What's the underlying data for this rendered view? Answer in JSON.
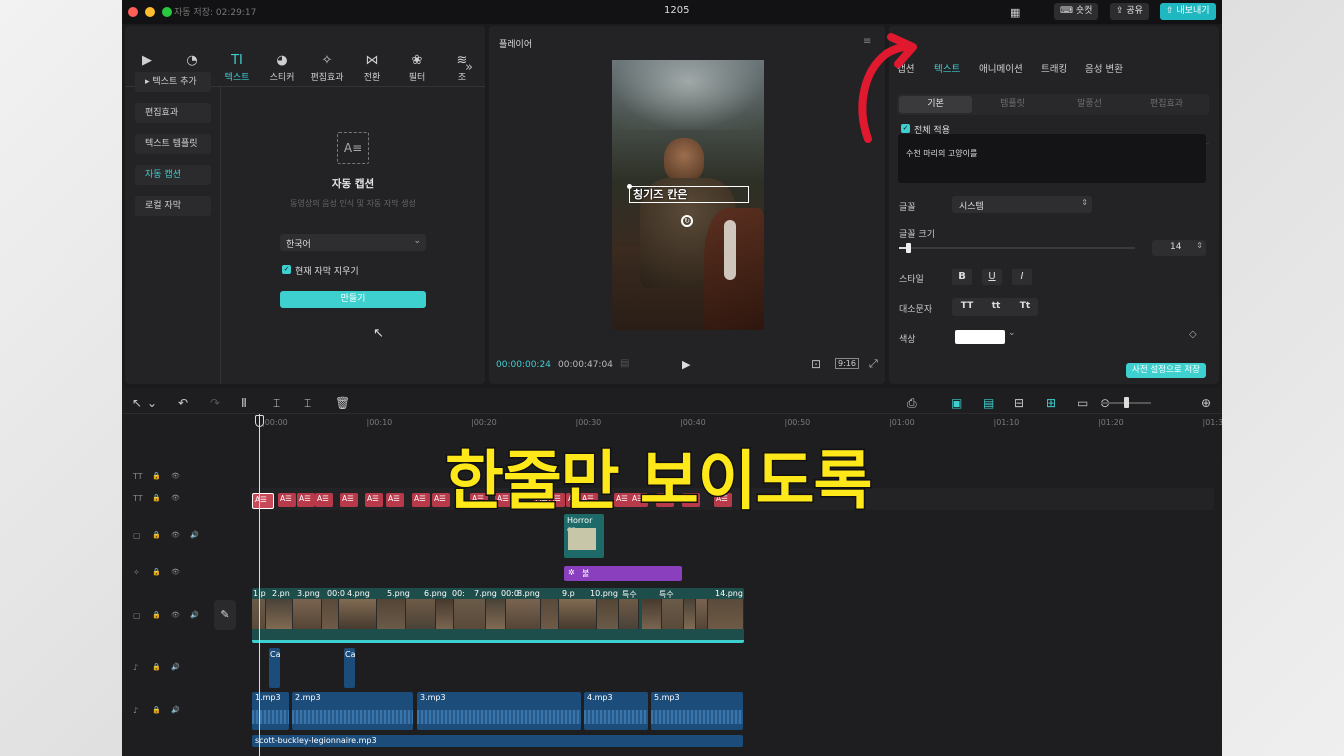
{
  "titlebar": {
    "autosave": "자동 저장: 02:29:17",
    "project_name": "1205",
    "shortcut_label": "숏컷",
    "share_label": "공유",
    "export_label": "내보내기"
  },
  "toolbar": {
    "items": [
      {
        "label": "미디어",
        "icon": "media-icon"
      },
      {
        "label": "오디오",
        "icon": "audio-icon"
      },
      {
        "label": "텍스트",
        "icon": "text-icon"
      },
      {
        "label": "스티커",
        "icon": "sticker-icon"
      },
      {
        "label": "편집효과",
        "icon": "effects-icon"
      },
      {
        "label": "전환",
        "icon": "transition-icon"
      },
      {
        "label": "필터",
        "icon": "filter-icon"
      },
      {
        "label": "조",
        "icon": "adjust-icon"
      }
    ],
    "active": "텍스트"
  },
  "sidebar": {
    "items": [
      "텍스트 추가",
      "편집효과",
      "텍스트 템플릿",
      "자동 캡션",
      "로컬 자막"
    ],
    "active": "자동 캡션"
  },
  "caption_panel": {
    "title": "자동 캡션",
    "description": "동영상의 음성 인식 및 자동 자막 생성",
    "language": "한국어",
    "checkbox_label": "현재 자막 지우기",
    "create_button": "만들기"
  },
  "player": {
    "title": "플레이어",
    "caption_text": "칭기즈 칸은",
    "current_time": "00:00:00:24",
    "total_time": "00:00:47:04",
    "aspect": "9:16"
  },
  "inspector": {
    "tabs": [
      "캡션",
      "텍스트",
      "애니메이션",
      "트래킹",
      "음성 변환"
    ],
    "active_tab": "텍스트",
    "subtabs": [
      "기본",
      "템플릿",
      "말풍선",
      "편집효과"
    ],
    "active_subtab": "기본",
    "apply_all": "전체 적용",
    "text_value": "수천 마리의 고양이를",
    "font_label": "글꼴",
    "font_value": "시스템",
    "size_label": "글꼴 크기",
    "size_value": "14",
    "size_fraction": 0.03,
    "style_label": "스타일",
    "style_buttons": [
      "B",
      "U",
      "I"
    ],
    "case_label": "대소문자",
    "case_buttons": [
      "TT",
      "tt",
      "Tt"
    ],
    "color_label": "색상",
    "color_value": "#ffffff",
    "save_preset": "사전 설정으로 저장"
  },
  "timeline": {
    "ruler": [
      "00:00",
      "00:10",
      "00:20",
      "00:30",
      "00:40",
      "00:50",
      "01:00",
      "01:10",
      "01:20",
      "01:30"
    ],
    "overlay_clip": "Horror ca",
    "effect_clip": "불",
    "video_clips": [
      "1.p",
      "2.pn",
      "3.png",
      "00:0",
      "4.png",
      "5.png",
      "6.png",
      "00:",
      "7.png",
      "00:0",
      "8.png",
      "9.p",
      "10.png",
      "특수",
      "특수",
      "14.png"
    ],
    "small_audio": [
      "Ca",
      "Ca"
    ],
    "audio_clips": [
      "1.mp3",
      "2.mp3",
      "3.mp3",
      "4.mp3",
      "5.mp3"
    ],
    "music_clip": "scott-buckley-legionnaire.mp3",
    "text_clip": "A"
  },
  "overlay_caption": "한줄만 보이도록",
  "colors": {
    "accent": "#3ecfcf",
    "text_clip": "#b83a4a",
    "effect_clip": "#8a3fbf",
    "audio_clip": "#1c4d7a",
    "arrow": "#e0192f",
    "overlay_text": "#ffe81a"
  }
}
